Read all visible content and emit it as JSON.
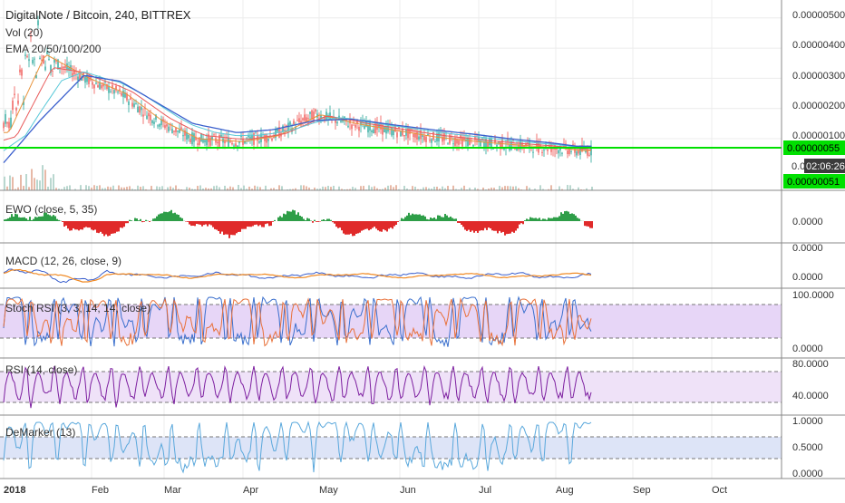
{
  "header": {
    "title": "DigitalNote / Bitcoin, 240, BITTREX",
    "vol_label": "Vol (20)",
    "ema_label": "EMA 20/50/100/200"
  },
  "price_panel": {
    "ticks": [
      "0.00000500",
      "0.00000400",
      "0.00000300",
      "0.00000200",
      "0.00000100"
    ],
    "tick_values": [
      5.0,
      4.0,
      3.0,
      2.0,
      1.0
    ],
    "last_price": "0.00000055",
    "countdown": "02:06:26",
    "countdown_prefix": "0.0",
    "bid_price": "0.00000051",
    "support_level": 0.55,
    "colors": {
      "support": "#00e000",
      "candle_up": "#26a69a",
      "candle_down": "#ef5350",
      "ema20": "#e8923a",
      "ema50": "#e85a5a",
      "ema100": "#58c8d8",
      "ema200": "#3a5fcd"
    }
  },
  "indicators": {
    "ewo": {
      "label": "EWO (close, 5, 35)",
      "tick": "0.0000"
    },
    "macd": {
      "label": "MACD (12, 26, close, 9)",
      "ticks": [
        "0.0000",
        "0.0000"
      ]
    },
    "stoch_rsi": {
      "label": "Stoch RSI (3, 3, 14, 14, close)",
      "ticks": [
        "100.0000",
        "0.0000"
      ]
    },
    "rsi": {
      "label": "RSI (14, close)",
      "ticks": [
        "80.0000",
        "40.0000"
      ]
    },
    "demarker": {
      "label": "DeMarker (13)",
      "ticks": [
        "1.0000",
        "0.5000",
        "0.0000"
      ]
    }
  },
  "time_axis": {
    "labels": [
      "2018",
      "Feb",
      "Mar",
      "Apr",
      "May",
      "Jun",
      "Jul",
      "Aug",
      "Sep",
      "Oct"
    ]
  },
  "chart_data": {
    "type": "line",
    "title": "DigitalNote / Bitcoin, 240, BITTREX",
    "x": [
      "2018-01-01",
      "2018-01-15",
      "2018-02-01",
      "2018-02-15",
      "2018-03-01",
      "2018-03-15",
      "2018-04-01",
      "2018-04-15",
      "2018-05-01",
      "2018-05-15",
      "2018-06-01",
      "2018-06-15",
      "2018-07-01",
      "2018-07-15",
      "2018-08-01",
      "2018-08-10"
    ],
    "series": [
      {
        "name": "EMA 200",
        "values": [
          0.2,
          1.6,
          3.1,
          2.9,
          2.2,
          1.5,
          1.2,
          1.3,
          1.6,
          1.65,
          1.45,
          1.3,
          1.15,
          1.0,
          0.85,
          0.75
        ]
      },
      {
        "name": "EMA 20",
        "values": [
          1.2,
          3.8,
          3.0,
          2.5,
          1.6,
          1.0,
          0.9,
          1.1,
          1.8,
          1.5,
          1.25,
          1.05,
          0.9,
          0.8,
          0.7,
          0.6
        ]
      }
    ],
    "ylim": [
      0.35,
      5.0
    ],
    "y_unit": "BTC × 1e-6",
    "grid": true
  }
}
